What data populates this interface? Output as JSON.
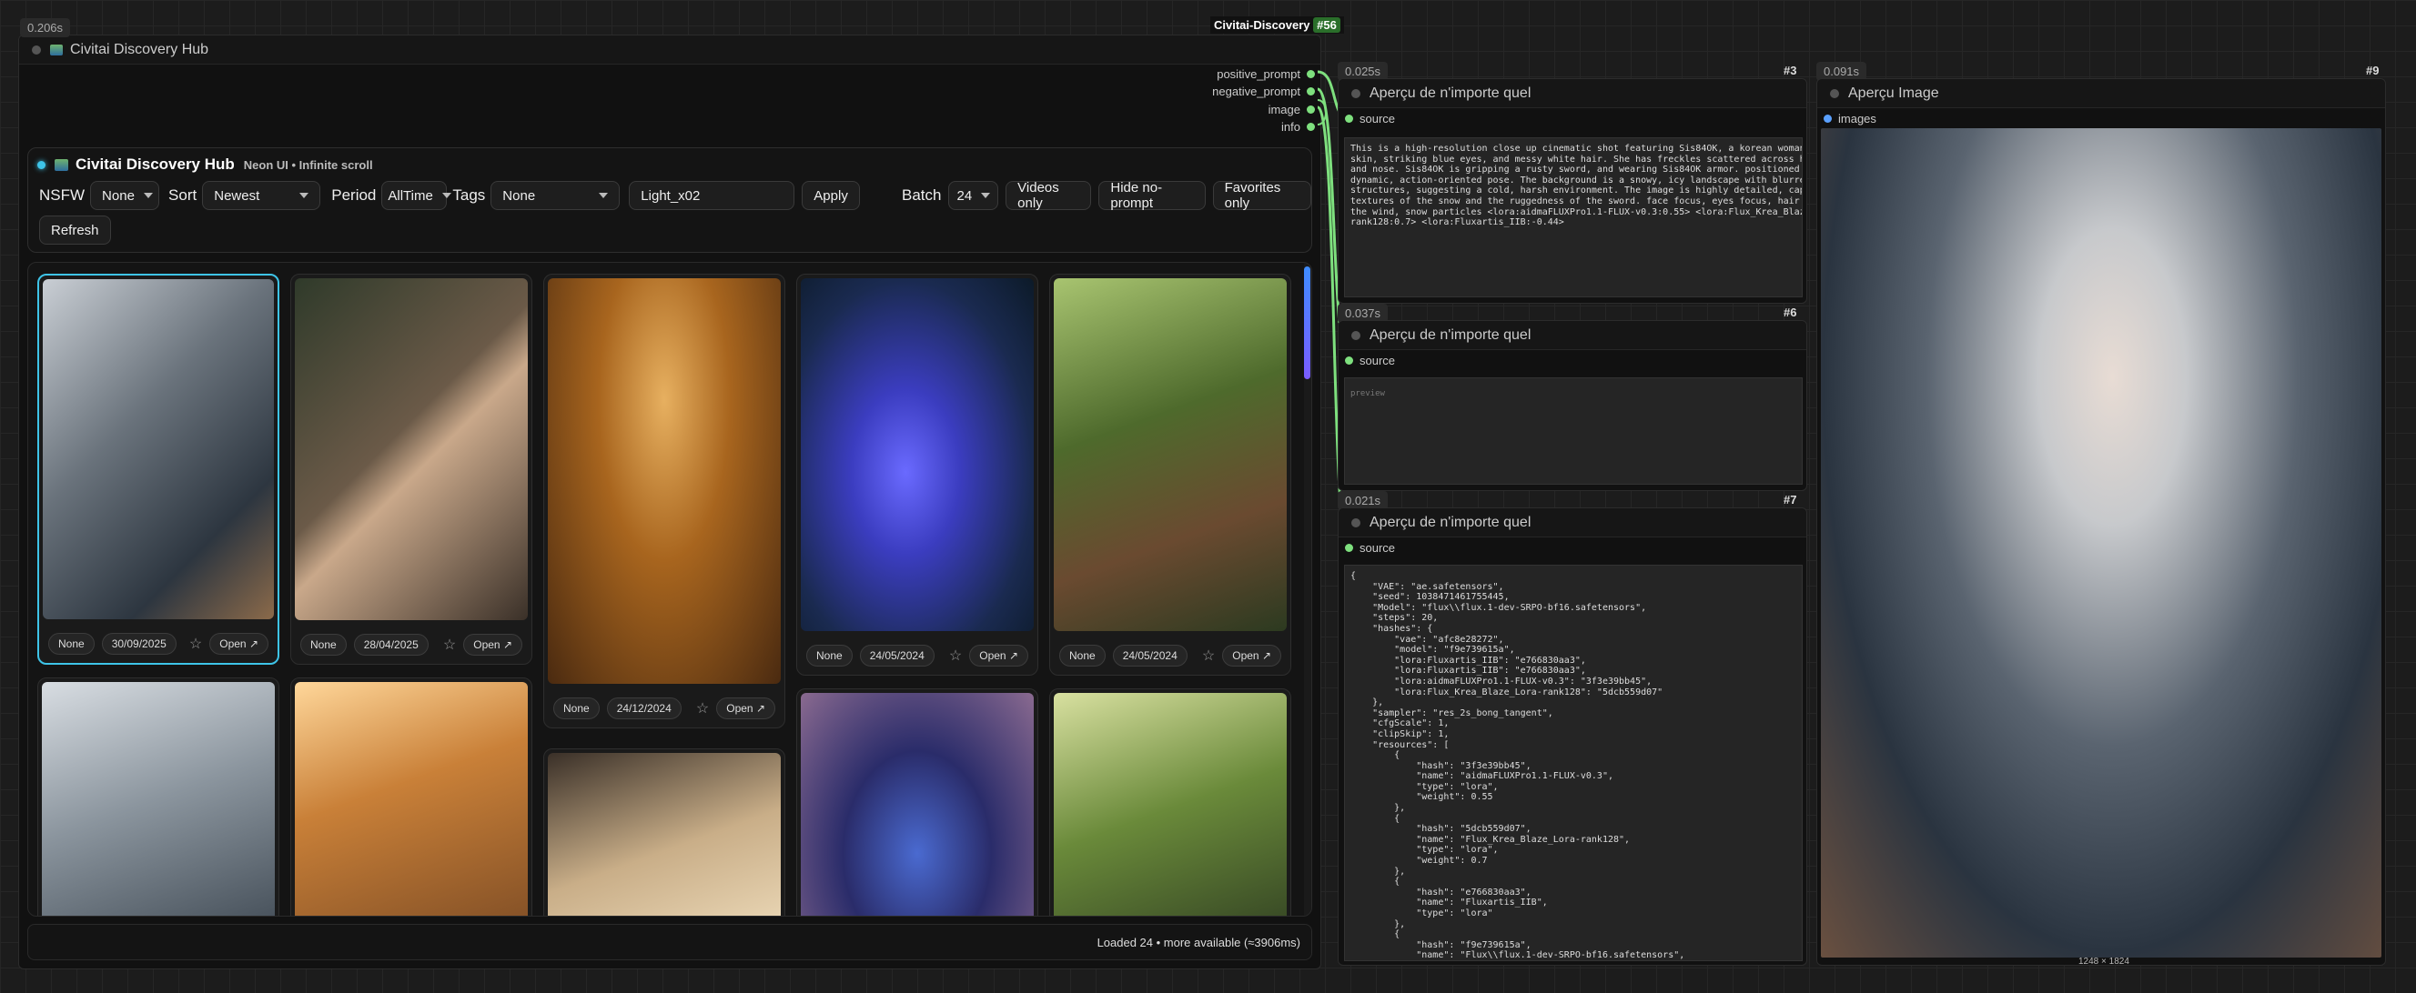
{
  "node56": {
    "timing": "0.206s",
    "id": "#56",
    "tag": "Civitai-Discovery",
    "title_icon": "image-icon",
    "title": "Civitai Discovery Hub",
    "outputs": [
      "positive_prompt",
      "negative_prompt",
      "image",
      "info"
    ]
  },
  "hub": {
    "title": "Civitai Discovery Hub",
    "subtitle": "Neon UI • Infinite scroll",
    "nsfw_label": "NSFW",
    "nsfw_value": "None",
    "sort_label": "Sort",
    "sort_value": "Newest",
    "period_label": "Period",
    "period_value": "AllTime",
    "tags_label": "Tags",
    "tags_value": "None",
    "search_value": "Light_x02",
    "apply": "Apply",
    "batch_label": "Batch",
    "batch_value": "24",
    "videos_only": "Videos only",
    "hide_noprompt": "Hide no-prompt",
    "favorites_only": "Favorites only",
    "refresh": "Refresh",
    "status": "Loaded 24 • more available (≈3906ms)"
  },
  "cards": [
    {
      "nsfw": "None",
      "date": "30/09/2025",
      "open": "Open ↗",
      "star": "☆",
      "bg": "#5c6670"
    },
    {
      "nsfw": "None",
      "date": "28/04/2025",
      "open": "Open ↗",
      "star": "☆",
      "bg": "#4a4036"
    },
    {
      "nsfw": "None",
      "date": "24/12/2024",
      "open": "Open ↗",
      "star": "☆",
      "bg": "#a0621c"
    },
    {
      "nsfw": "None",
      "date": "24/05/2024",
      "open": "Open ↗",
      "star": "☆",
      "bg": "#23305e"
    },
    {
      "nsfw": "None",
      "date": "24/05/2024",
      "open": "Open ↗",
      "star": "☆",
      "bg": "#3e5a2a"
    }
  ],
  "lower_cards": [
    {
      "bg": "#7a8490"
    },
    {
      "bg": "#b07038"
    },
    {
      "bg": "#5a4a38"
    },
    {
      "bg": "#2a2c5a"
    },
    {
      "bg": "#4f6a30"
    }
  ],
  "node3": {
    "timing": "0.025s",
    "id": "#3",
    "title": "Aperçu de n'importe quel",
    "input": "source",
    "text": "This is a high-resolution close up cinematic shot featuring Sis84OK, a korean woman with pale\nskin, striking blue eyes, and messy white hair. She has freckles scattered across her cheeks\nand nose. Sis84OK is gripping a rusty sword, and wearing Sis84OK armor. positioned in a\ndynamic, action-oriented pose. The background is a snowy, icy landscape with blurred, jagged\nstructures, suggesting a cold, harsh environment. The image is highly detailed, capturing\ntextures of the snow and the ruggedness of the sword. face focus, eyes focus, hair flowing in\nthe wind, snow particles <lora:aidmaFLUXPro1.1-FLUX-v0.3:0.55> <lora:Flux_Krea_Blaze_Lora-\nrank128:0.7> <lora:Fluxartis_IIB:-0.44>"
  },
  "node6": {
    "timing": "0.037s",
    "id": "#6",
    "title": "Aperçu de n'importe quel",
    "input": "source",
    "placeholder": "preview"
  },
  "node7": {
    "timing": "0.021s",
    "id": "#7",
    "title": "Aperçu de n'importe quel",
    "input": "source",
    "text": "{\n    \"VAE\": \"ae.safetensors\",\n    \"seed\": 1038471461755445,\n    \"Model\": \"flux\\\\flux.1-dev-SRPO-bf16.safetensors\",\n    \"steps\": 20,\n    \"hashes\": {\n        \"vae\": \"afc8e28272\",\n        \"model\": \"f9e739615a\",\n        \"lora:Fluxartis_IIB\": \"e766830aa3\",\n        \"lora:Fluxartis_IIB\": \"e766830aa3\",\n        \"lora:aidmaFLUXPro1.1-FLUX-v0.3\": \"3f3e39bb45\",\n        \"lora:Flux_Krea_Blaze_Lora-rank128\": \"5dcb559d07\"\n    },\n    \"sampler\": \"res_2s_bong_tangent\",\n    \"cfgScale\": 1,\n    \"clipSkip\": 1,\n    \"resources\": [\n        {\n            \"hash\": \"3f3e39bb45\",\n            \"name\": \"aidmaFLUXPro1.1-FLUX-v0.3\",\n            \"type\": \"lora\",\n            \"weight\": 0.55\n        },\n        {\n            \"hash\": \"5dcb559d07\",\n            \"name\": \"Flux_Krea_Blaze_Lora-rank128\",\n            \"type\": \"lora\",\n            \"weight\": 0.7\n        },\n        {\n            \"hash\": \"e766830aa3\",\n            \"name\": \"Fluxartis_IIB\",\n            \"type\": \"lora\"\n        },\n        {\n            \"hash\": \"f9e739615a\",\n            \"name\": \"Flux\\\\flux.1-dev-SRPO-bf16.safetensors\","
  },
  "node9": {
    "timing": "0.091s",
    "id": "#9",
    "title": "Aperçu Image",
    "input": "images",
    "dims": "1248 × 1824"
  }
}
